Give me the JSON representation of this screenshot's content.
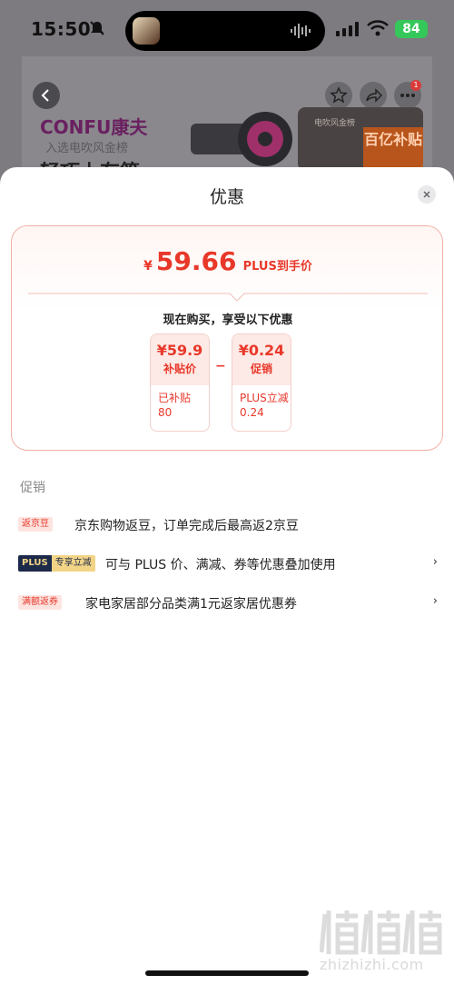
{
  "status_bar": {
    "time": "15:50",
    "battery": "84"
  },
  "background_page": {
    "brand": "CONFU康夫",
    "brand_sub": "入选电吹风金榜",
    "title_fragment": "轻巧上有第",
    "side_card_text": "电吹风金榜",
    "side_promo": "百亿补贴",
    "more_badge": "1"
  },
  "sheet": {
    "title": "优惠",
    "price": {
      "yen": "¥",
      "amount": "59.66",
      "suffix": "PLUS到手价"
    },
    "enjoy_text": "现在购买，享受以下优惠",
    "minus": "−",
    "benefits": [
      {
        "value": "¥59.9",
        "name": "补贴价",
        "detail_line1": "已补贴",
        "detail_line2": "80"
      },
      {
        "value": "¥0.24",
        "name": "促销",
        "detail_line1": "PLUS立减",
        "detail_line2": "0.24"
      }
    ],
    "promo_heading": "促销",
    "promotions": [
      {
        "tag": "返京豆",
        "text": "京东购物返豆，订单完成后最高返2京豆"
      },
      {
        "tag_a": "PLUS",
        "tag_b": "专享立减",
        "text": "可与 PLUS 价、满减、券等优惠叠加使用",
        "chevron": "›"
      },
      {
        "tag": "满额返券",
        "text": "家电家居部分品类满1元返家居优惠券",
        "chevron": "›"
      }
    ]
  },
  "watermark": {
    "text": "zhizhizhi.com",
    "logo": "值值值"
  }
}
